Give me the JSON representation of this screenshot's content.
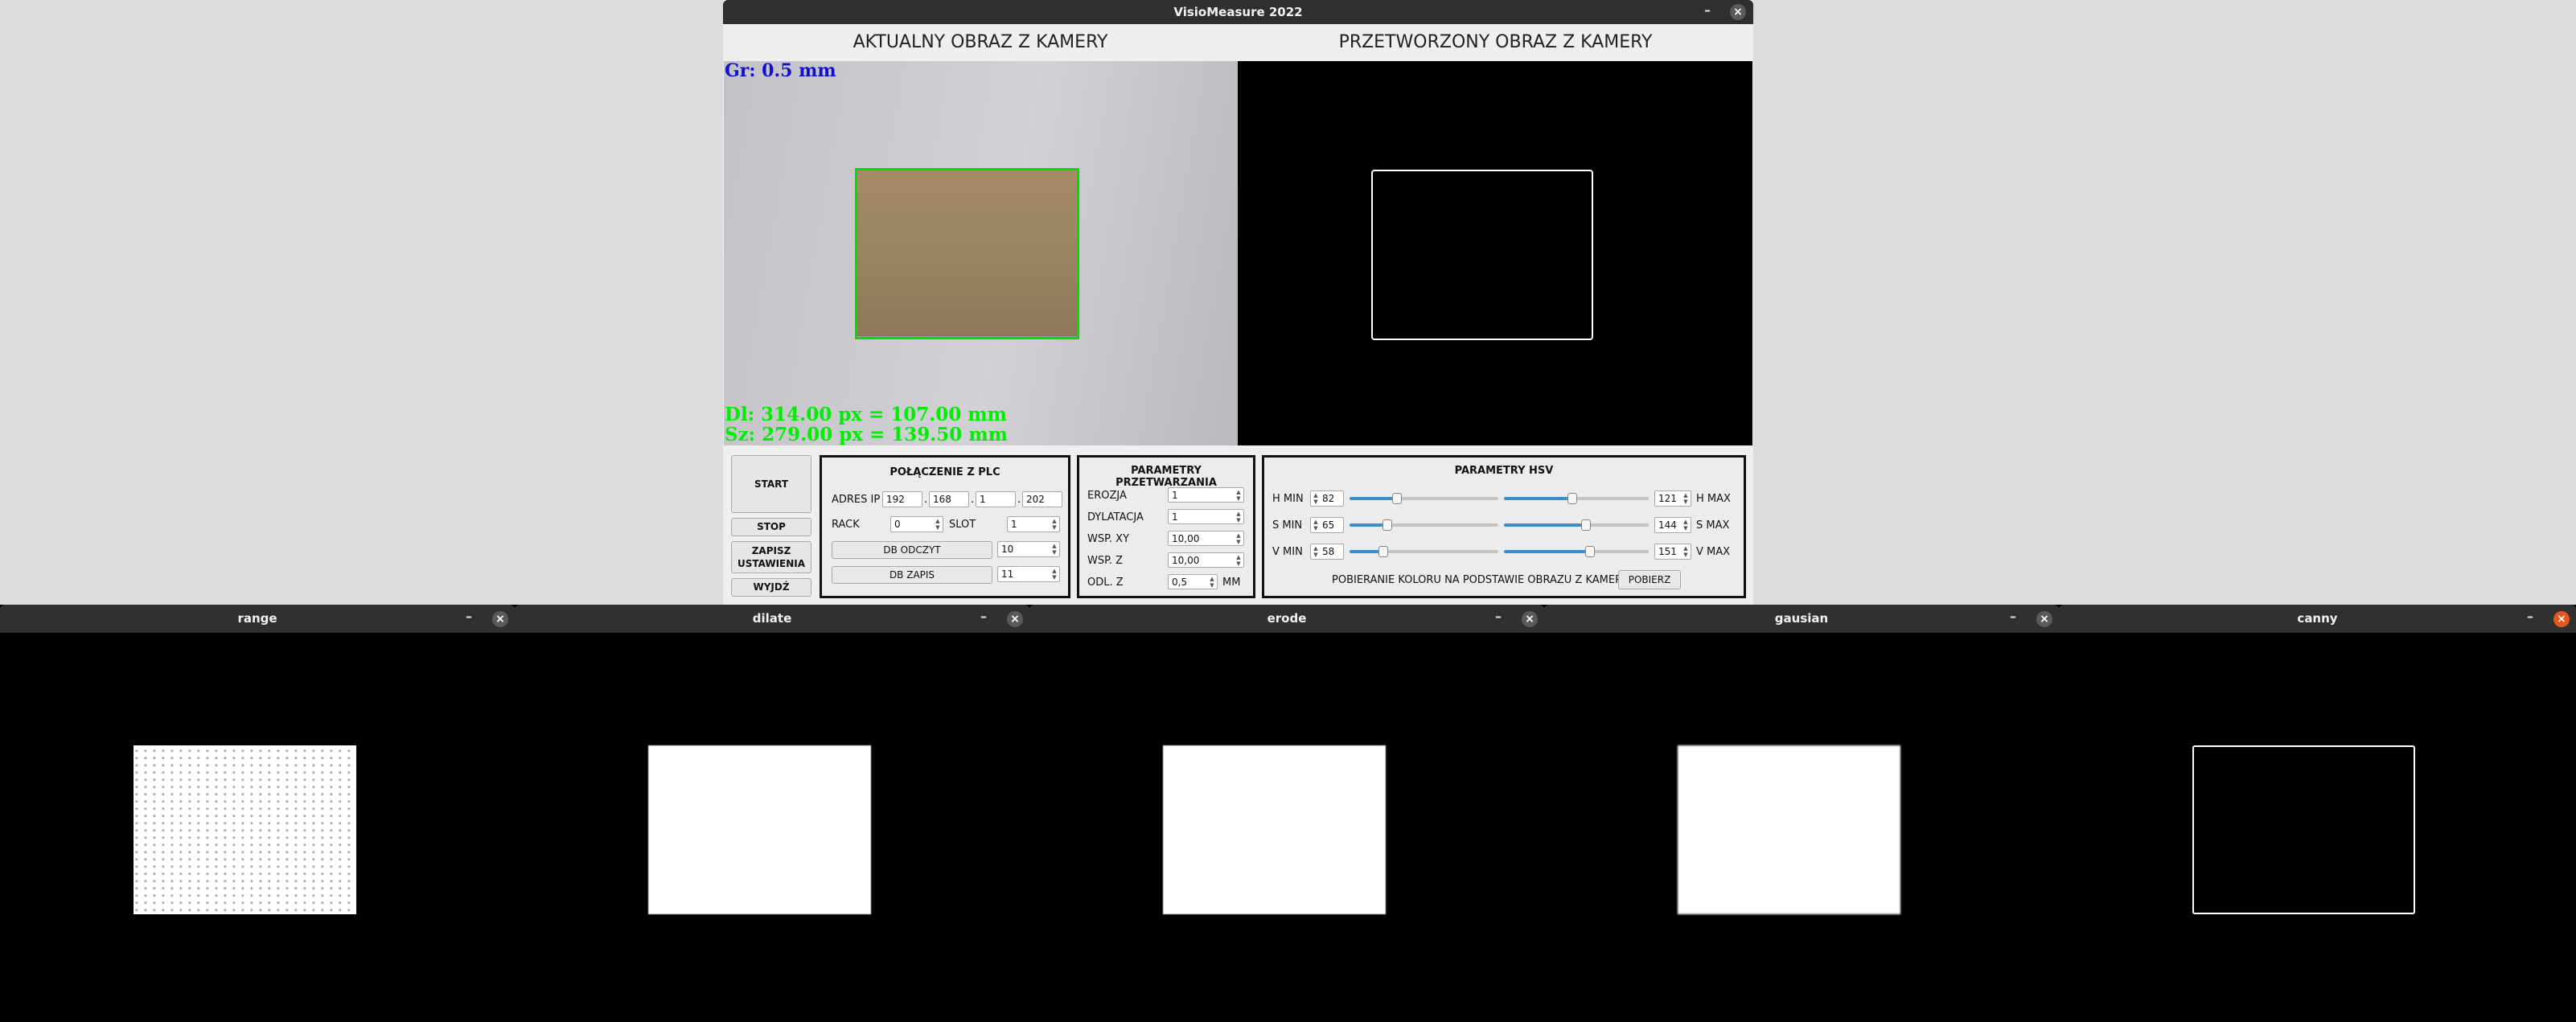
{
  "main_window": {
    "title": "VisioMeasure 2022",
    "minimize": "–",
    "close": "×",
    "left_header": "AKTUALNY OBRAZ Z KAMERY",
    "right_header": "PRZETWORZONY OBRAZ Z KAMERY",
    "overlay": {
      "grubosc": "Gr: 0.5 mm",
      "dlugosc": "Dl: 314.00 px = 107.00 mm",
      "szerokosc": "Sz: 279.00 px = 139.50 mm"
    }
  },
  "controls": {
    "start": "START",
    "stop": "STOP",
    "save_line1": "ZAPISZ",
    "save_line2": "USTAWIENIA",
    "exit": "WYJDŹ"
  },
  "plc": {
    "title": "POŁĄCZENIE Z PLC",
    "ip_label": "ADRES IP",
    "ip": [
      "192",
      "168",
      "1",
      "202"
    ],
    "ip_sep": ".",
    "rack_label": "RACK",
    "rack": "0",
    "slot_label": "SLOT",
    "slot": "1",
    "db_read_label": "DB ODCZYT",
    "db_read": "10",
    "db_write_label": "DB ZAPIS",
    "db_write": "11"
  },
  "processing": {
    "title": "PARAMETRY PRZETWARZANIA",
    "erozja_label": "EROZJA",
    "erozja": "1",
    "dylatacja_label": "DYLATACJA",
    "dylatacja": "1",
    "wsp_xy_label": "WSP. XY",
    "wsp_xy": "10,00",
    "wsp_z_label": "WSP. Z",
    "wsp_z": "10,00",
    "odl_z_label": "ODL. Z",
    "odl_z": "0,5",
    "odl_z_unit": "MM"
  },
  "hsv": {
    "title": "PARAMETRY HSV",
    "h_min_label": "H MIN",
    "h_min": "82",
    "h_max_label": "H MAX",
    "h_max": "121",
    "s_min_label": "S MIN",
    "s_min": "65",
    "s_max_label": "S MAX",
    "s_max": "144",
    "v_min_label": "V MIN",
    "v_min": "58",
    "v_max_label": "V MAX",
    "v_max": "151",
    "color_pick_label": "POBIERANIE KOLORU NA PODSTAWIE OBRAZU Z KAMERY",
    "pick_button": "POBIERZ",
    "slider_max": 255
  },
  "windows": [
    {
      "title": "range"
    },
    {
      "title": "dilate"
    },
    {
      "title": "erode"
    },
    {
      "title": "gausian"
    },
    {
      "title": "canny"
    }
  ],
  "colors": {
    "overlay_blue": "#1010d0",
    "overlay_green": "#00ee00",
    "slider_accent": "#3d8fcb",
    "close_active": "#e9541f"
  }
}
